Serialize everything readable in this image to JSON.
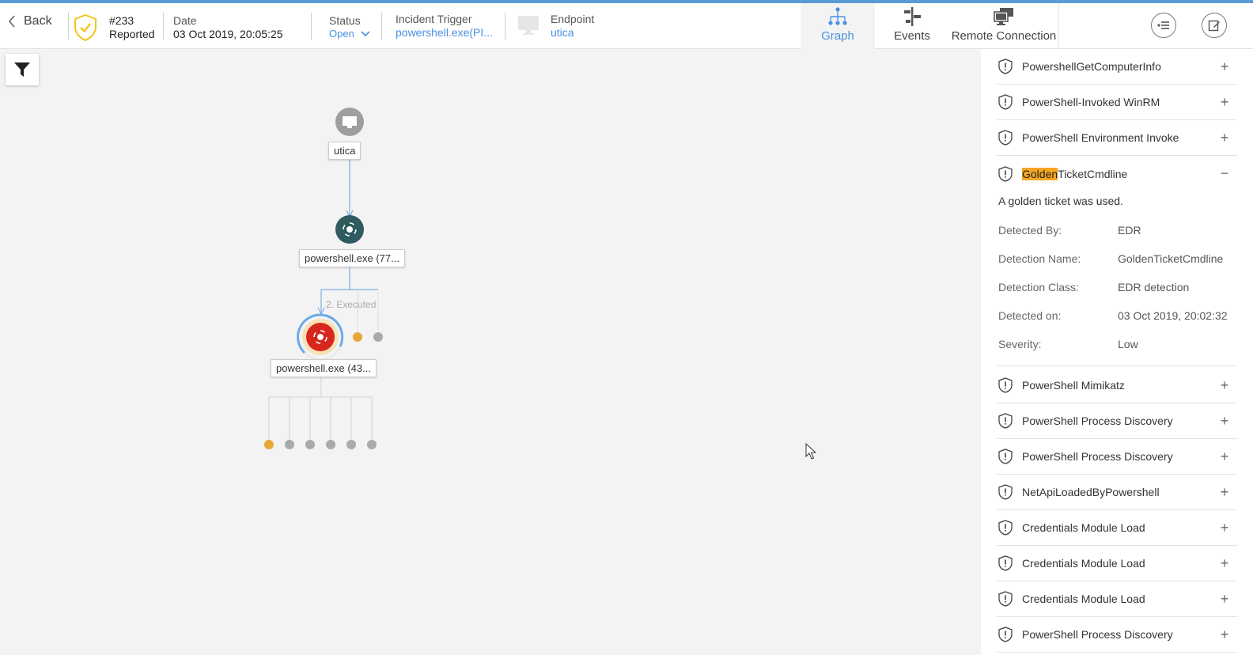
{
  "header": {
    "back_label": "Back",
    "incident_id": "#233",
    "incident_state": "Reported",
    "date_label": "Date",
    "date_value": "03 Oct 2019, 20:05:25",
    "status_label": "Status",
    "status_value": "Open",
    "trigger_label": "Incident Trigger",
    "trigger_value": "powershell.exe(PI...",
    "endpoint_label": "Endpoint",
    "endpoint_value": "utica"
  },
  "tabs": [
    {
      "label": "Graph",
      "icon": "graph-tree-icon",
      "active": true
    },
    {
      "label": "Events",
      "icon": "timeline-icon",
      "active": false
    },
    {
      "label": "Remote Connection",
      "icon": "remote-monitors-icon",
      "active": false
    }
  ],
  "header_actions": [
    "list-details-icon",
    "edit-note-icon"
  ],
  "graph": {
    "nodes": {
      "endpoint": "utica",
      "parent_process": "powershell.exe (77...",
      "child_process": "powershell.exe (43..."
    },
    "edge_label": "2. Executed"
  },
  "detections": [
    {
      "name": "PowershellGetComputerInfo",
      "expanded": false
    },
    {
      "name": "PowerShell-Invoked WinRM",
      "expanded": false
    },
    {
      "name": "PowerShell Environment Invoke",
      "expanded": false
    },
    {
      "name_highlight": "Golden",
      "name_rest": "TicketCmdline",
      "expanded": true
    },
    {
      "name": "PowerShell Mimikatz",
      "expanded": false
    },
    {
      "name": "PowerShell Process Discovery",
      "expanded": false
    },
    {
      "name": "PowerShell Process Discovery",
      "expanded": false
    },
    {
      "name": "NetApiLoadedByPowershell",
      "expanded": false
    },
    {
      "name": "Credentials Module Load",
      "expanded": false
    },
    {
      "name": "Credentials Module Load",
      "expanded": false
    },
    {
      "name": "Credentials Module Load",
      "expanded": false
    },
    {
      "name": "PowerShell Process Discovery",
      "expanded": false
    }
  ],
  "expanded_detail": {
    "description": "A golden ticket was used.",
    "fields": [
      {
        "key": "Detected By:",
        "value": "EDR"
      },
      {
        "key": "Detection Name:",
        "value": "GoldenTicketCmdline"
      },
      {
        "key": "Detection Class:",
        "value": "EDR detection"
      },
      {
        "key": "Detected on:",
        "value": "03 Oct 2019, 20:02:32"
      },
      {
        "key": "Severity:",
        "value": "Low"
      }
    ]
  },
  "toggle_symbols": {
    "collapsed": "+",
    "expanded": "−"
  },
  "colors": {
    "accent": "#4a90e2",
    "highlight": "#f5a623",
    "process_node": "#2f5a5e",
    "alert_node": "#d9261c",
    "shield_yellow": "#f2c515",
    "dot_orange": "#e8a838",
    "dot_gray": "#aaaaaa"
  }
}
